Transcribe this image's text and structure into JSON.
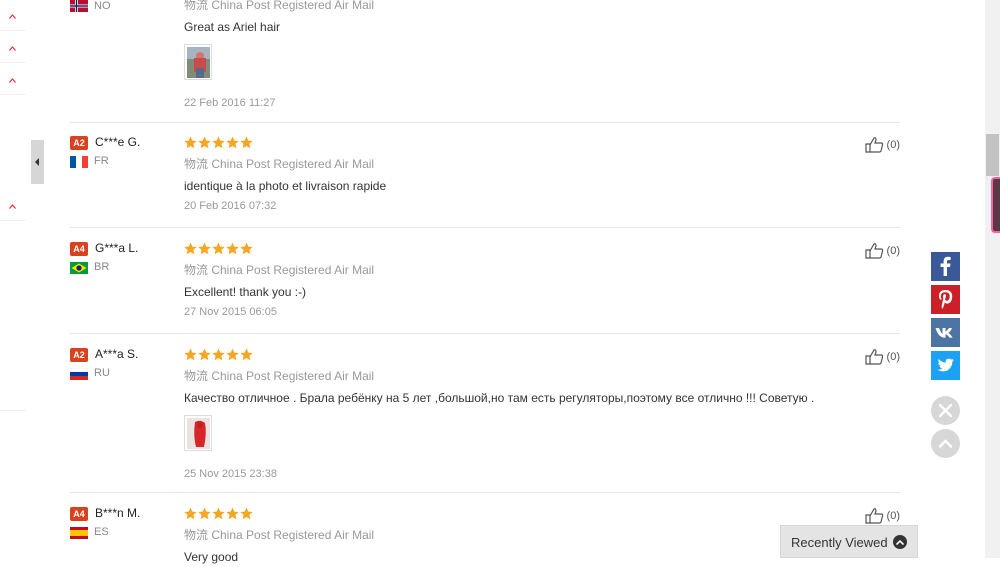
{
  "reviews": [
    {
      "level": "",
      "name": "",
      "country": "NO",
      "shipping": "物流 China Post Registered Air Mail",
      "text": "Great as Ariel hair",
      "date": "22 Feb 2016 11:27",
      "has_photo": true,
      "helpful": ""
    },
    {
      "level": "A2",
      "name": "C***e G.",
      "country": "FR",
      "shipping": "物流 China Post Registered Air Mail",
      "text": "identique à la photo et livraison rapide",
      "date": "20 Feb 2016 07:32",
      "has_photo": false,
      "helpful": "(0)"
    },
    {
      "level": "A4",
      "name": "G***a L.",
      "country": "BR",
      "shipping": "物流 China Post Registered Air Mail",
      "text": "Excellent! thank you :-)",
      "date": "27 Nov 2015 06:05",
      "has_photo": false,
      "helpful": "(0)"
    },
    {
      "level": "A2",
      "name": "A***a S.",
      "country": "RU",
      "shipping": "物流 China Post Registered Air Mail",
      "text": "Качество отличное . Брала ребёнку на 5 лет ,большой,но там есть регуляторы,поэтому все отлично !!! Советую .",
      "date": "25 Nov 2015 23:38",
      "has_photo": true,
      "helpful": "(0)"
    },
    {
      "level": "A4",
      "name": "B***n M.",
      "country": "ES",
      "shipping": "物流 China Post Registered Air Mail",
      "text": "Very good",
      "date": "",
      "has_photo": false,
      "helpful": "(0)"
    }
  ],
  "rating_stars": 5,
  "recently_viewed": {
    "label": "Recently Viewed"
  },
  "social": [
    "facebook-icon",
    "pinterest-icon",
    "vk-icon",
    "twitter-icon"
  ],
  "colors": {
    "star": "#f5a623",
    "badge": "#d9421e",
    "facebook": "#3b5998",
    "pinterest": "#cb2027",
    "vk": "#4c75a3",
    "twitter": "#1da1f2"
  }
}
